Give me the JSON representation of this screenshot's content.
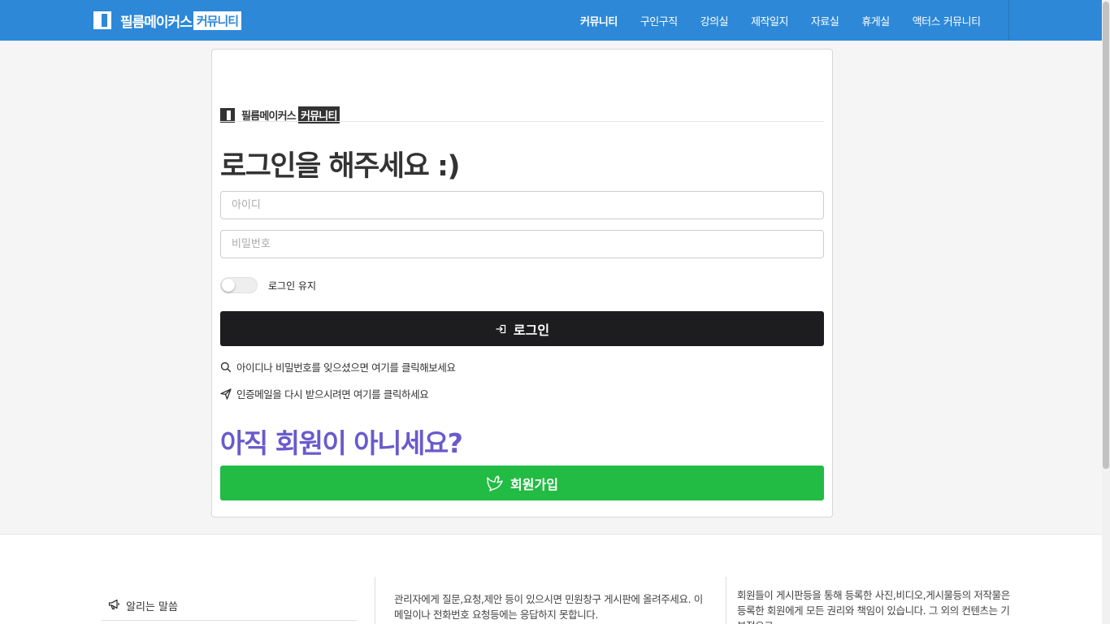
{
  "brand": {
    "name": "필름메이커스",
    "tag": "커뮤니티"
  },
  "nav": {
    "items": [
      {
        "label": "커뮤니티",
        "active": true
      },
      {
        "label": "구인구직"
      },
      {
        "label": "강의실"
      },
      {
        "label": "제작일지"
      },
      {
        "label": "자료실"
      },
      {
        "label": "휴게실"
      },
      {
        "label": "액터스 커뮤니티"
      }
    ]
  },
  "login": {
    "title": "로그인을 해주세요 :)",
    "id_placeholder": "아이디",
    "pw_placeholder": "비밀번호",
    "keep_login_label": "로그인 유지",
    "keep_login_on": false,
    "submit_label": "로그인",
    "find_account_link": "아이디나 비밀번호를 잊으셨으면 여기를 클릭해보세요",
    "resend_mail_link": "인증메일을 다시 받으시려면 여기를 클릭하세요"
  },
  "join": {
    "title": "아직 회원이 아니세요?",
    "button_label": "회원가입"
  },
  "footer": {
    "notice_label": "알리는 말씀",
    "text_1": "관리자에게 질문,요청,제안 등이 있으시면 민원창구 게시판에 올려주세요. 이메일이나 전화번호 요청등에는 응답하지 못합니다.",
    "text_2": "회원들이 게시판등을 통해 등록한 사진,비디오,게시물등의 저작물은 등록한 회원에게 모든 권리와 책임이 있습니다. 그 외의 컨텐츠는 기본적으로"
  },
  "colors": {
    "navbar": "#2d88d8",
    "login_button": "#1d1d1f",
    "join_button": "#22bb44",
    "join_title": "#6a5acd"
  },
  "icons": {
    "login": "sign-in-icon",
    "find": "search-icon",
    "resend": "paper-plane-icon",
    "join": "dove-icon",
    "notice": "megaphone-icon"
  }
}
